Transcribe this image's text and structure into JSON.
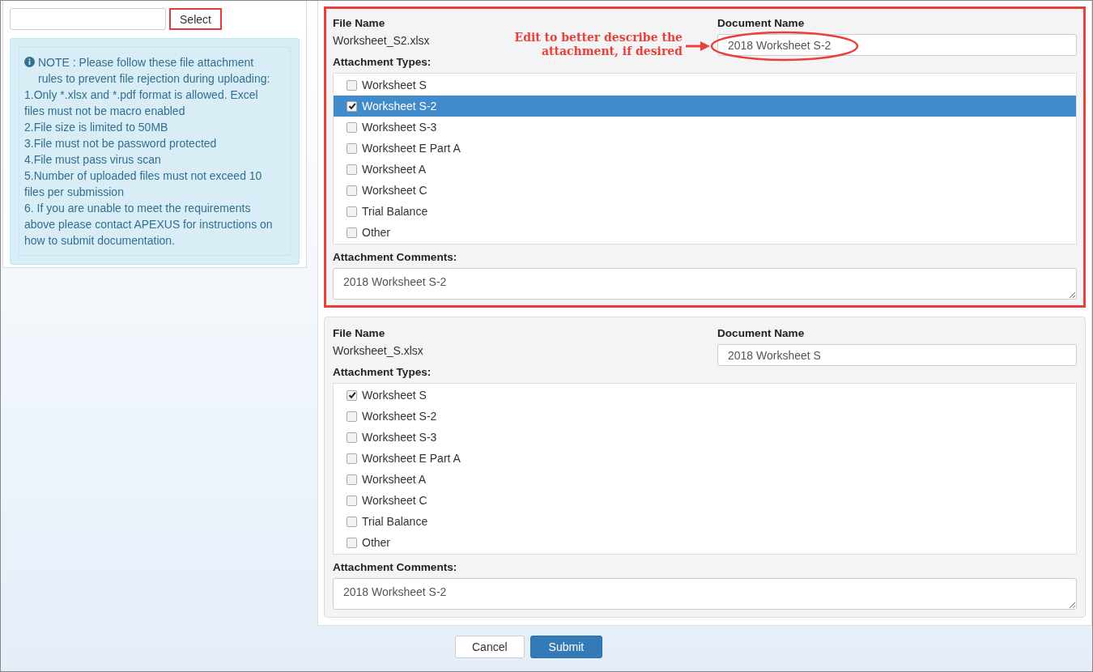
{
  "select_button": {
    "label": "Select",
    "highlighted": true
  },
  "note": {
    "lines": [
      "NOTE : Please follow these file attachment rules to prevent file rejection during uploading:",
      "1.Only *.xlsx and *.pdf format is allowed. Excel files must not be macro enabled",
      "2.File size is limited to 50MB",
      "3.File must not be password protected",
      "4.File must pass virus scan",
      "5.Number of uploaded files must not exceed 10 files per submission",
      "6. If you are unable to meet the requirements above please contact APEXUS for instructions on how to submit documentation."
    ]
  },
  "annotation": {
    "lines": [
      "Edit to better describe the",
      "attachment, if desired"
    ]
  },
  "attachments": [
    {
      "highlighted": true,
      "file_name_label": "File Name",
      "file_name": "Worksheet_S2.xlsx",
      "document_name_label": "Document Name",
      "document_name": "2018 Worksheet S-2",
      "types_label": "Attachment Types:",
      "types": [
        {
          "label": "Worksheet S",
          "checked": false,
          "selected": false
        },
        {
          "label": "Worksheet S-2",
          "checked": true,
          "selected": true
        },
        {
          "label": "Worksheet S-3",
          "checked": false,
          "selected": false
        },
        {
          "label": "Worksheet E Part A",
          "checked": false,
          "selected": false
        },
        {
          "label": "Worksheet A",
          "checked": false,
          "selected": false
        },
        {
          "label": "Worksheet C",
          "checked": false,
          "selected": false
        },
        {
          "label": "Trial Balance",
          "checked": false,
          "selected": false
        },
        {
          "label": "Other",
          "checked": false,
          "selected": false
        }
      ],
      "comments_label": "Attachment Comments:",
      "comments": "2018 Worksheet S-2"
    },
    {
      "highlighted": false,
      "file_name_label": "File Name",
      "file_name": "Worksheet_S.xlsx",
      "document_name_label": "Document Name",
      "document_name": "2018 Worksheet S",
      "types_label": "Attachment Types:",
      "types": [
        {
          "label": "Worksheet S",
          "checked": true,
          "selected": false
        },
        {
          "label": "Worksheet S-2",
          "checked": false,
          "selected": false
        },
        {
          "label": "Worksheet S-3",
          "checked": false,
          "selected": false
        },
        {
          "label": "Worksheet E Part A",
          "checked": false,
          "selected": false
        },
        {
          "label": "Worksheet A",
          "checked": false,
          "selected": false
        },
        {
          "label": "Worksheet C",
          "checked": false,
          "selected": false
        },
        {
          "label": "Trial Balance",
          "checked": false,
          "selected": false
        },
        {
          "label": "Other",
          "checked": false,
          "selected": false
        }
      ],
      "comments_label": "Attachment Comments:",
      "comments": "2018 Worksheet S-2"
    }
  ],
  "buttons": [
    {
      "label": "Cancel",
      "kind": "default"
    },
    {
      "label": "Submit",
      "kind": "primary"
    }
  ]
}
